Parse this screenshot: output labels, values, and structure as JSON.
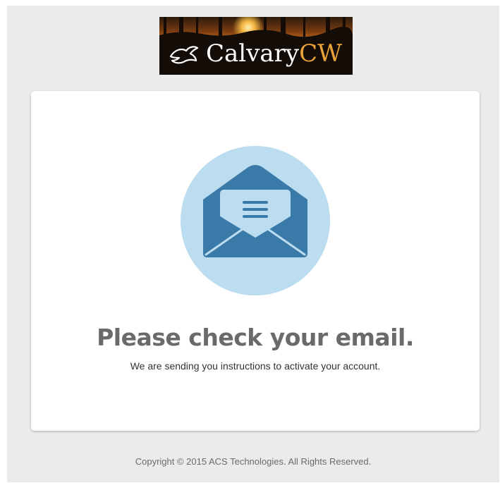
{
  "brand": {
    "name_part1": "Calvary",
    "name_part2": "CW"
  },
  "confirmation": {
    "title": "Please check your email.",
    "message": "We are sending you instructions to activate your account."
  },
  "icons": {
    "logo_mark": "dove-icon",
    "main": "open-envelope-icon"
  },
  "colors": {
    "page_background": "#ebebeb",
    "card_background": "#ffffff",
    "icon_circle": "#bcdcef",
    "envelope": "#3a7aa8",
    "headline": "#6a6a6a",
    "logo_accent": "#e9a23a"
  },
  "footer": {
    "copyright": "Copyright © 2015 ACS Technologies. All Rights Reserved."
  }
}
